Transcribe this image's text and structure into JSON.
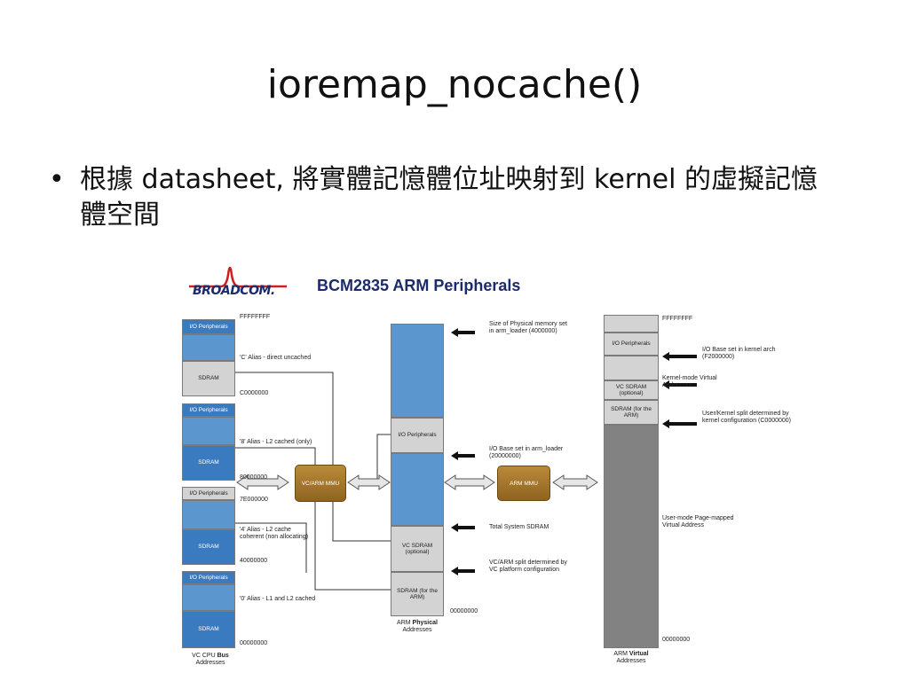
{
  "slide": {
    "title": "ioremap_nocache()",
    "bullet_char": "•",
    "bullet_text": "根據 datasheet, 將實體記憶體位址映射到 kernel 的虛擬記憶體空間"
  },
  "diagram": {
    "logo": "BROADCOM.",
    "title": "BCM2835 ARM Peripherals",
    "vc_bus": {
      "blocks": [
        {
          "label": "I/O Peripherals"
        },
        {
          "label": ""
        },
        {
          "label": "SDRAM"
        },
        {
          "label": "I/O Peripherals"
        },
        {
          "label": ""
        },
        {
          "label": "SDRAM"
        },
        {
          "label": "I/O Peripherals"
        },
        {
          "label": ""
        },
        {
          "label": "SDRAM"
        },
        {
          "label": "I/O Peripherals"
        },
        {
          "label": ""
        },
        {
          "label": "SDRAM"
        }
      ],
      "addresses": [
        "FFFFFFFF",
        "C0000000",
        "80000000",
        "7E000000",
        "40000000",
        "00000000"
      ],
      "aliases": [
        "'C' Alias - direct uncached",
        "'8' Alias - L2 cached (only)",
        "'4' Alias - L2 cache",
        "coherent (non allocating)",
        "'0' Alias - L1 and L2 cached"
      ],
      "caption": "VC CPU",
      "caption_bold": "Bus",
      "caption2": "Addresses"
    },
    "vc_mmu": "VC/ARM MMU",
    "arm_mmu": "ARM MMU",
    "arm_physical": {
      "blocks": [
        {
          "label": ""
        },
        {
          "label": "I/O Peripherals"
        },
        {
          "label": ""
        },
        {
          "label": "VC SDRAM (optional)"
        },
        {
          "label": "SDRAM (for the ARM)"
        }
      ],
      "address": "00000000",
      "caption": "ARM",
      "caption_bold": "Physical",
      "caption2": "Addresses",
      "notes": [
        "Size of Physical memory set in arm_loader (4000000)",
        "I/O Base set in arm_loader (20000000)",
        "Total System SDRAM",
        "VC/ARM split determined by VC platform configuration"
      ]
    },
    "arm_virtual": {
      "blocks": [
        {
          "label": ""
        },
        {
          "label": "I/O Peripherals"
        },
        {
          "label": ""
        },
        {
          "label": "VC SDRAM (optional)"
        },
        {
          "label": "SDRAM (for the ARM)"
        },
        {
          "label": ""
        }
      ],
      "addresses": [
        "FFFFFFFF",
        "00000000"
      ],
      "caption": "ARM",
      "caption_bold": "Virtual",
      "caption2": "Addresses",
      "notes": [
        "I/O Base set in kernel arch (F2000000)",
        "Kernel-mode Virtual Addresses",
        "User/Kernel split determined by kernel configuration (C0000000)",
        "User-mode Page-mapped Virtual Address"
      ]
    }
  }
}
